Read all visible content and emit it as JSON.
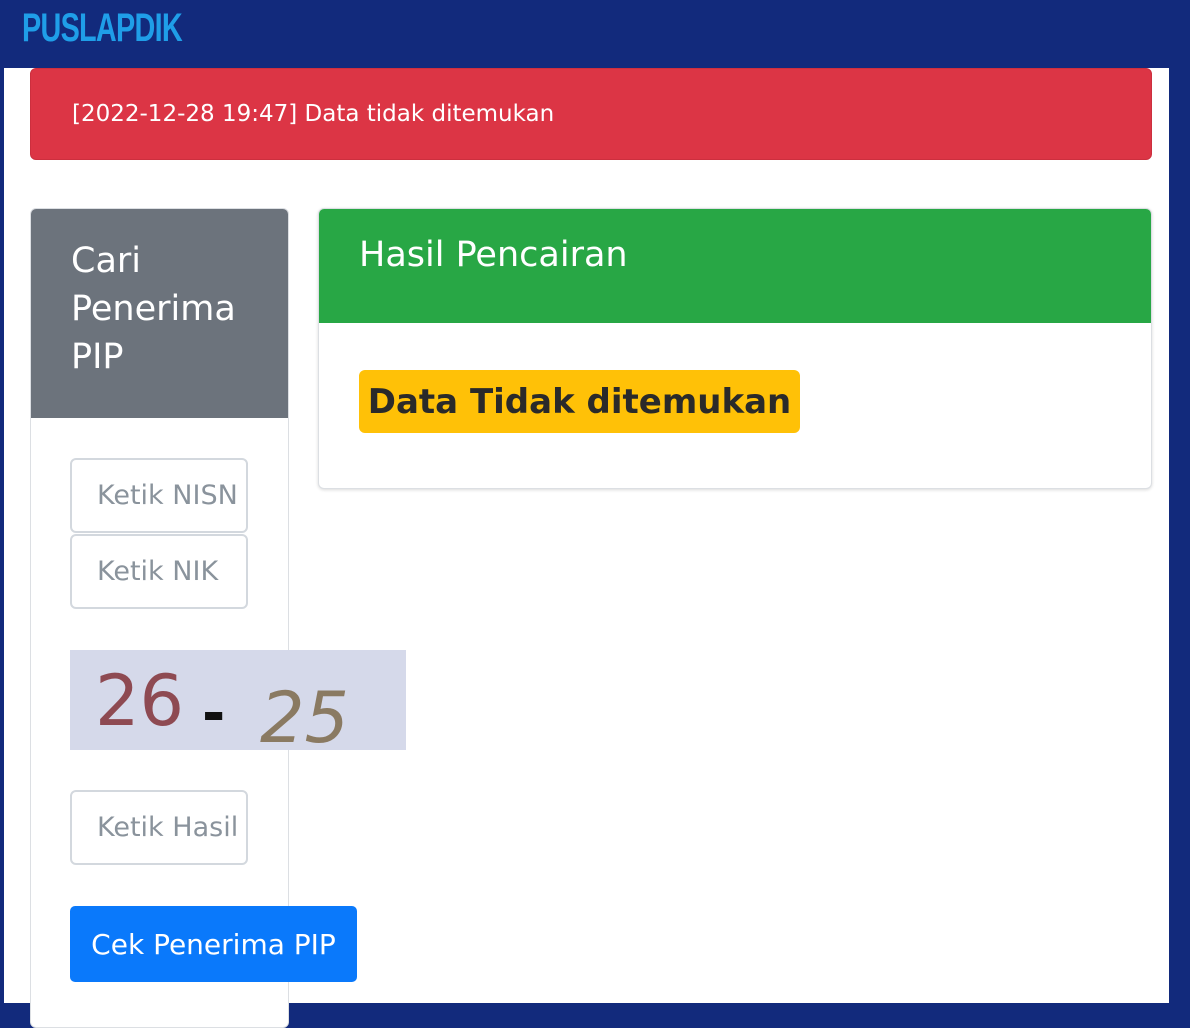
{
  "header": {
    "brand": "PUSLAPDIK"
  },
  "alert": {
    "message": "[2022-12-28 19:47] Data tidak ditemukan",
    "color": "#dc3545"
  },
  "search_card": {
    "title": "Cari Penerima PIP",
    "nisn_placeholder": "Ketik NISN",
    "nik_placeholder": "Ketik NIK",
    "captcha": {
      "left": "26",
      "operator": "-",
      "right": "25"
    },
    "result_placeholder": "Ketik Hasil",
    "submit_label": "Cek Penerima PIP"
  },
  "result_card": {
    "title": "Hasil Pencairan",
    "status_badge": "Data Tidak ditemukan"
  },
  "colors": {
    "navbar": "#122a7c",
    "brand": "#1f9ee8",
    "search_header": "#6c737c",
    "result_header": "#28a745",
    "badge": "#ffc107",
    "button": "#0a79fb"
  }
}
